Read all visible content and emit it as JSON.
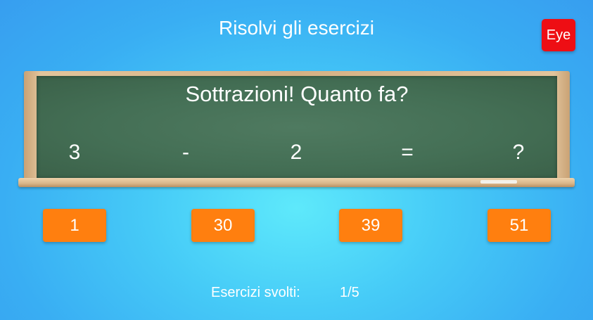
{
  "header": {
    "title": "Risolvi gli esercizi",
    "eye_button_label": "Eye"
  },
  "board": {
    "question": "Sottrazioni! Quanto fa?",
    "expression": {
      "operand1": "3",
      "operator": "-",
      "operand2": "2",
      "equals": "=",
      "result": "?"
    }
  },
  "answers": [
    "1",
    "30",
    "39",
    "51"
  ],
  "footer": {
    "progress_label": "Esercizi svolti:",
    "progress_value": "1/5"
  },
  "colors": {
    "background_center": "#5ee9fb",
    "background_edge": "#379ef0",
    "answer_button": "#ff7f0f",
    "eye_button": "#ee0e14",
    "chalkboard": "#446f55",
    "board_frame": "#d5b184"
  }
}
